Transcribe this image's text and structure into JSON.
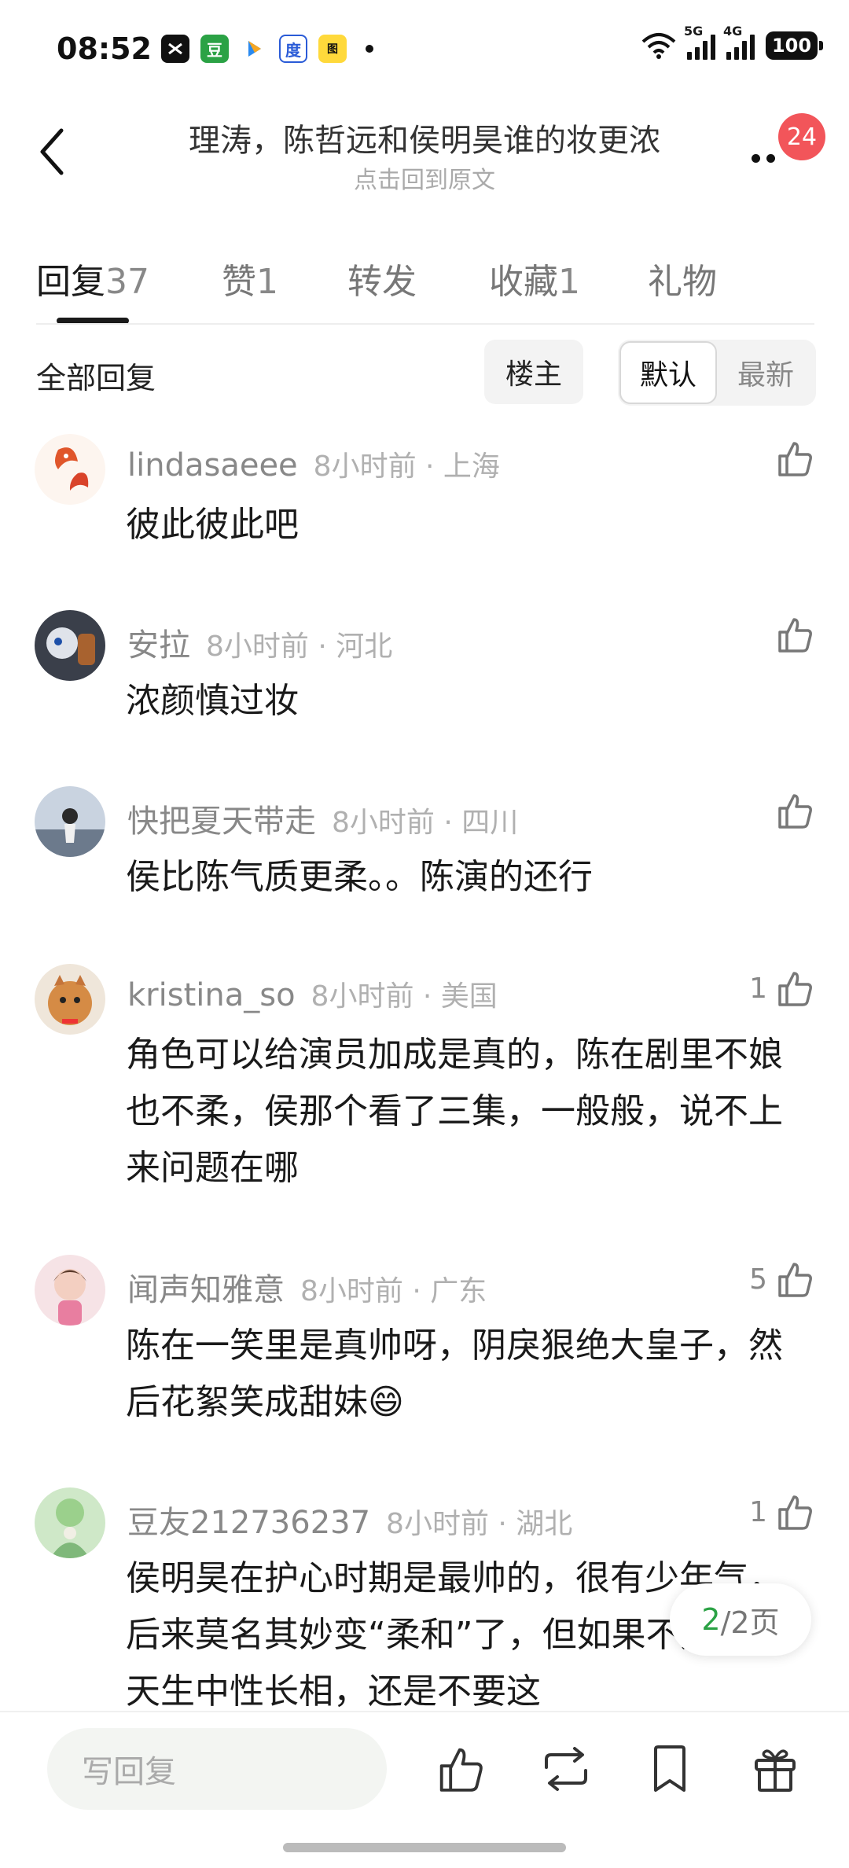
{
  "status_bar": {
    "time": "08:52",
    "network1": "5G",
    "network2": "4G",
    "battery": "100",
    "app_icons": [
      "capcut-icon",
      "douban-icon",
      "video-app-icon",
      "baidu-icon",
      "map-app-icon"
    ]
  },
  "header": {
    "title": "理涛，陈哲远和侯明昊谁的妆更浓",
    "subtitle": "点击回到原文",
    "notification_count": "24"
  },
  "tabs": [
    {
      "label": "回复",
      "count": "37"
    },
    {
      "label": "赞",
      "count": "1"
    },
    {
      "label": "转发",
      "count": ""
    },
    {
      "label": "收藏",
      "count": "1"
    },
    {
      "label": "礼物",
      "count": ""
    }
  ],
  "filter": {
    "label": "全部回复",
    "owner_chip": "楼主",
    "sort_default": "默认",
    "sort_latest": "最新"
  },
  "comments": [
    {
      "user": "lindasaeee",
      "time": "8小时前 · 上海",
      "likes": "",
      "text": "彼此彼此吧"
    },
    {
      "user": "安拉",
      "time": "8小时前 · 河北",
      "likes": "",
      "text": "浓颜慎过妆"
    },
    {
      "user": "快把夏天带走",
      "time": "8小时前 · 四川",
      "likes": "",
      "text": "侯比陈气质更柔。。陈演的还行"
    },
    {
      "user": "kristina_so",
      "time": "8小时前 · 美国",
      "likes": "1",
      "text": "角色可以给演员加成是真的，陈在剧里不娘也不柔，侯那个看了三集，一般般，说不上来问题在哪"
    },
    {
      "user": "闻声知雅意",
      "time": "8小时前 · 广东",
      "likes": "5",
      "text": "陈在一笑里是真帅呀，阴戾狠绝大皇子，然后花絮笑成甜妹😄"
    },
    {
      "user": "豆友212736237",
      "time": "8小时前 · 湖北",
      "likes": "1",
      "text": "侯明昊在护心时期是最帅的，很有少年气，后来莫名其妙变“柔和”了，但如果不是那种天生中性长相，还是不要这"
    }
  ],
  "pager": {
    "current": "2",
    "total": "/2页"
  },
  "bottom_bar": {
    "reply_placeholder": "写回复",
    "icons": [
      "thumbs-up-icon",
      "repost-icon",
      "bookmark-icon",
      "gift-icon"
    ]
  },
  "colors": {
    "accent_green": "#2ba245",
    "badge_red": "#f2555a",
    "text_primary": "#1a1a1a",
    "text_secondary": "#888888"
  }
}
